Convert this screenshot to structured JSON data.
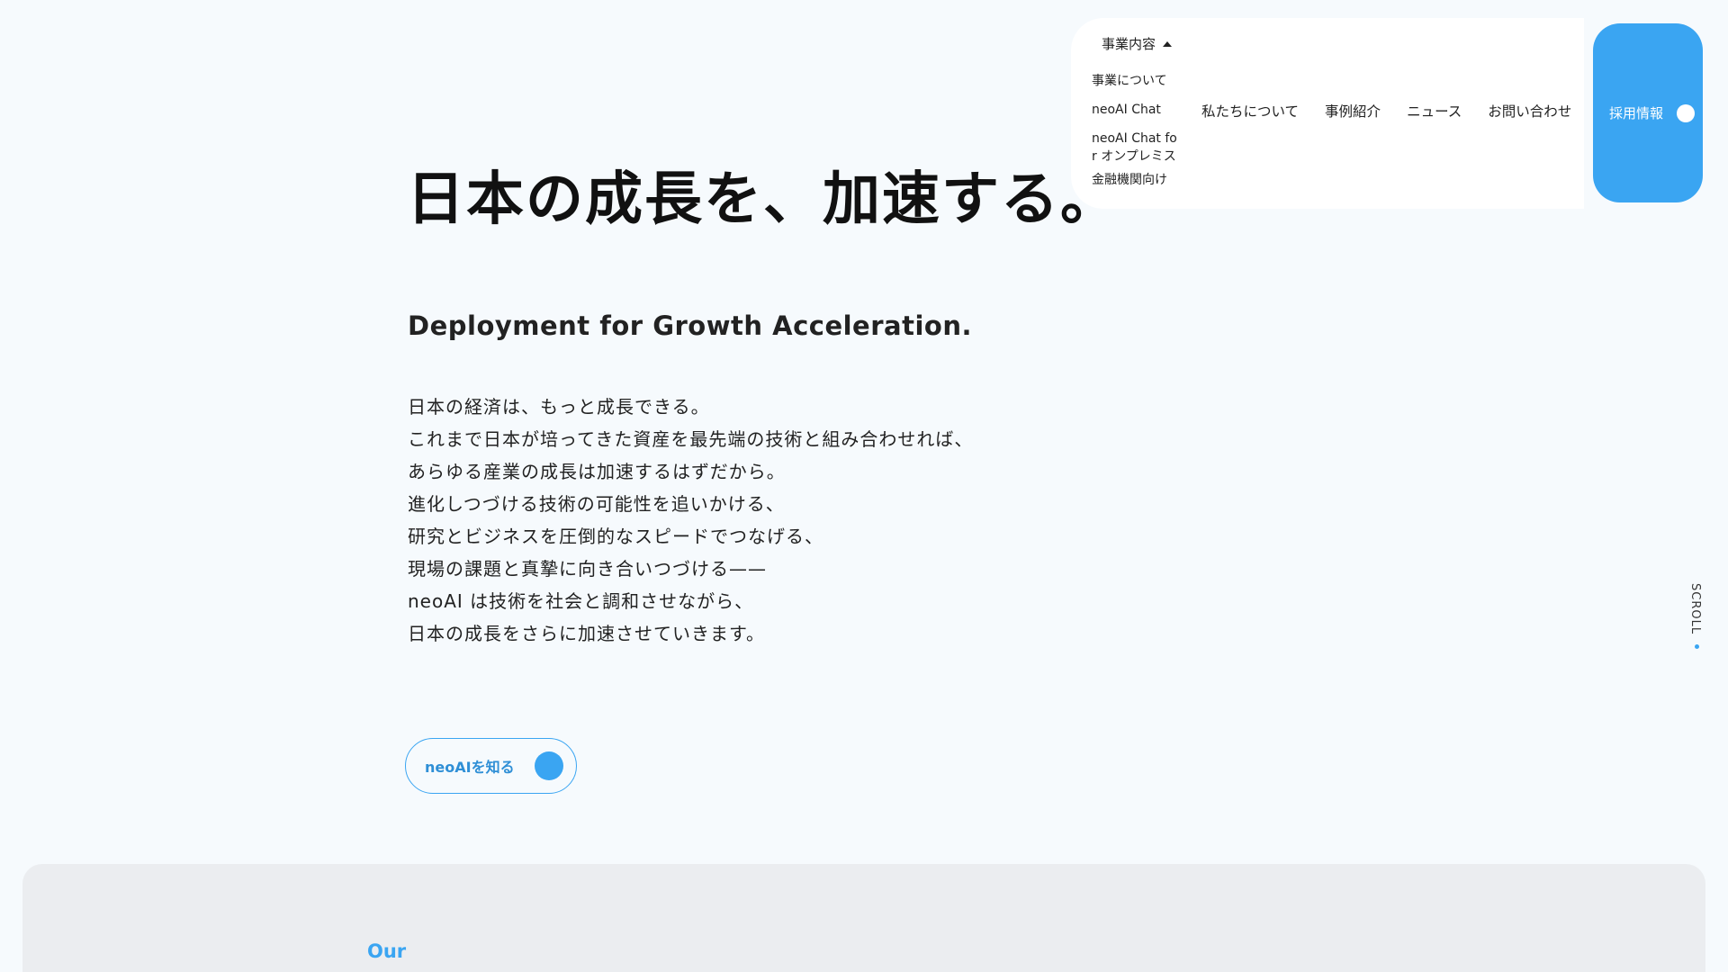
{
  "nav": {
    "dropdown": {
      "label": "事業内容",
      "items": [
        {
          "label": "事業について"
        },
        {
          "label": "neoAI Chat"
        },
        {
          "label": "neoAI Chat for オンプレミス"
        },
        {
          "label": "金融機関向け"
        }
      ]
    },
    "items": [
      {
        "label": "私たちについて"
      },
      {
        "label": "事例紹介"
      },
      {
        "label": "ニュース"
      },
      {
        "label": "お問い合わせ"
      }
    ],
    "recruit_label": "採用情報"
  },
  "hero": {
    "title": "日本の成長を、加速する。",
    "subtitle": "Deployment for Growth Acceleration.",
    "body": [
      "日本の経済は、もっと成長できる。",
      "これまで日本が培ってきた資産を最先端の技術と組み合わせれば、",
      "あらゆる産業の成長は加速するはずだから。",
      "進化しつづける技術の可能性を追いかける、",
      "研究とビジネスを圧倒的なスピードでつなげる、",
      "現場の課題と真摯に向き合いつづける——",
      "neoAI は技術を社会と調和させながら、",
      "日本の成長をさらに加速させていきます。"
    ],
    "cta_label": "neoAIを知る"
  },
  "scroll_label": "SCROLL",
  "lower_section": {
    "heading": "Our"
  },
  "colors": {
    "accent": "#3aa5f2",
    "background": "#f6fafd",
    "section_gray": "#ebedf0"
  }
}
